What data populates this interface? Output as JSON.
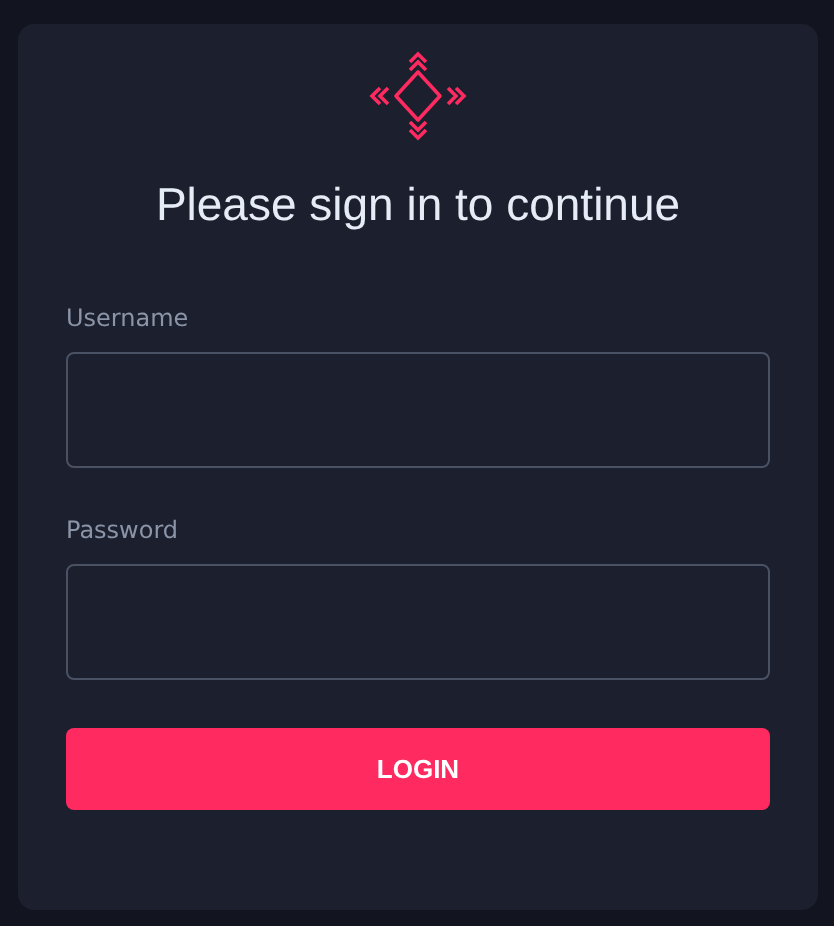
{
  "title": "Please sign in to continue",
  "fields": [
    {
      "label": "Username"
    },
    {
      "label": "Password"
    }
  ],
  "button": "LOGIN"
}
